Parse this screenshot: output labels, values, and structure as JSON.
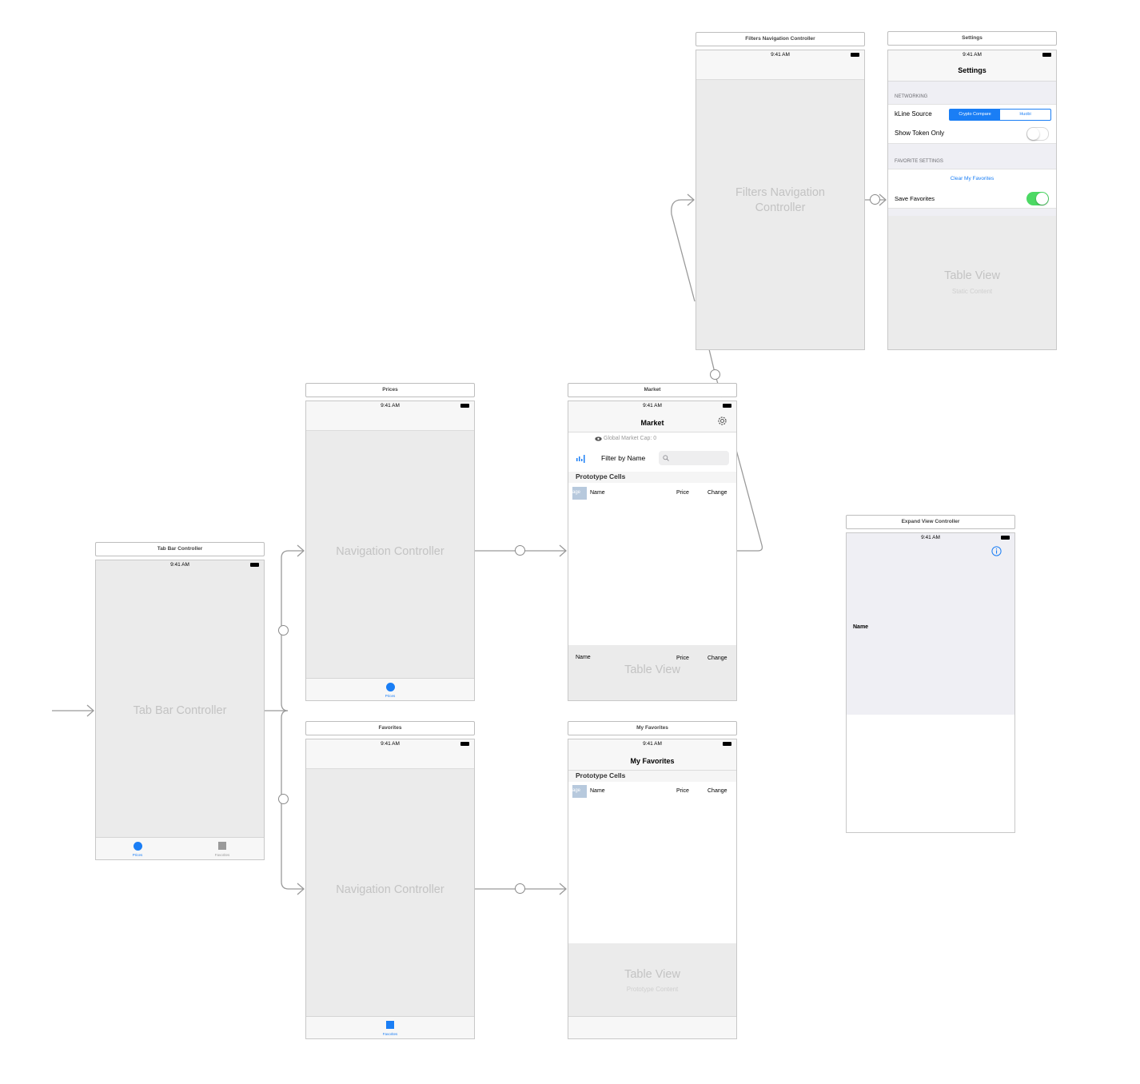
{
  "status_time": "9:41 AM",
  "scenes": {
    "tab_bar": {
      "title": "Tab Bar Controller",
      "center_label": "Tab Bar Controller",
      "tabs": [
        {
          "label": "Prices",
          "color": "#1a7ef5"
        },
        {
          "label": "Favorites",
          "color": "#9a9a9a"
        }
      ]
    },
    "prices_nav": {
      "title": "Prices",
      "center_label": "Navigation Controller",
      "tab_label": "Prices"
    },
    "favorites_nav": {
      "title": "Favorites",
      "center_label": "Navigation Controller",
      "tab_label": "Favorites"
    },
    "market": {
      "title": "Market",
      "nav_title": "Market",
      "global_cap": "Global Market Cap:  0",
      "filter_label": "Filter by Name",
      "prototype_header": "Prototype Cells",
      "cell_image": "age",
      "cell_name": "Name",
      "cell_price": "Price",
      "cell_change": "Change",
      "footer_name": "Name",
      "footer_price": "Price",
      "footer_change": "Change",
      "under_label": "Table View"
    },
    "my_favorites": {
      "title": "My Favorites",
      "nav_title": "My Favorites",
      "prototype_header": "Prototype Cells",
      "cell_image": "age",
      "cell_name": "Name",
      "cell_price": "Price",
      "cell_change": "Change",
      "table_label": "Table View",
      "table_sub": "Prototype Content"
    },
    "filters_nav": {
      "title": "Filters Navigation Controller",
      "center_label": "Filters Navigation Controller"
    },
    "settings": {
      "title": "Settings",
      "nav_title": "Settings",
      "section_networking": "NETWORKING",
      "kline_label": "kLine Source",
      "segments": [
        "Crypto Compare",
        "Huobi"
      ],
      "show_token_label": "Show Token Only",
      "show_token_on": false,
      "section_favorites": "FAVORITE SETTINGS",
      "clear_favorites": "Clear My Favorites",
      "save_favorites_label": "Save Favorites",
      "save_favorites_on": true,
      "table_label": "Table View",
      "table_sub": "Static Content"
    },
    "expand": {
      "title": "Expand View Controller",
      "name_label": "Name"
    }
  },
  "colors": {
    "accent": "#1a7ef5",
    "switch_on": "#4cd964"
  }
}
